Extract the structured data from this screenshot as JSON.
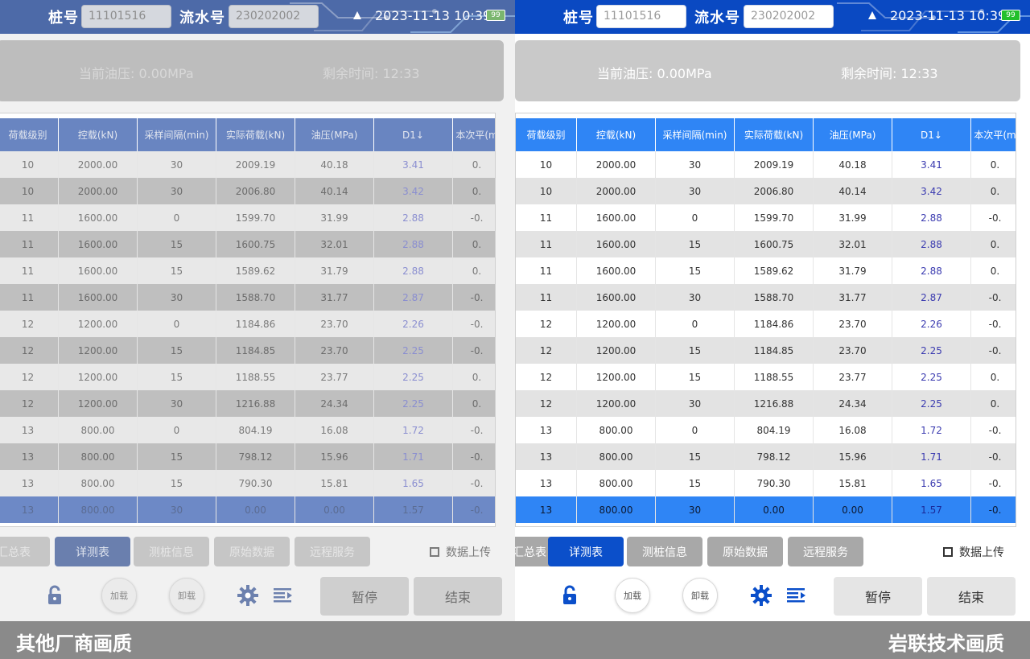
{
  "header": {
    "pile_label": "桩号",
    "pile_value": "11101516",
    "serial_label": "流水号",
    "serial_value": "230202002",
    "datetime": "2023-11-13  10:39",
    "battery": "99"
  },
  "status": {
    "pressure_label": "当前油压: 0.00MPa",
    "remaining_label": "剩余时间: 12:33"
  },
  "table": {
    "headers": [
      "荷载级别",
      "控载(kN)",
      "采样间隔(min)",
      "实际荷载(kN)",
      "油压(MPa)",
      "D1↓",
      "本次平(m"
    ],
    "rows": [
      [
        "10",
        "2000.00",
        "30",
        "2009.19",
        "40.18",
        "3.41",
        "0."
      ],
      [
        "10",
        "2000.00",
        "30",
        "2006.80",
        "40.14",
        "3.42",
        "0."
      ],
      [
        "11",
        "1600.00",
        "0",
        "1599.70",
        "31.99",
        "2.88",
        "-0."
      ],
      [
        "11",
        "1600.00",
        "15",
        "1600.75",
        "32.01",
        "2.88",
        "0."
      ],
      [
        "11",
        "1600.00",
        "15",
        "1589.62",
        "31.79",
        "2.88",
        "0."
      ],
      [
        "11",
        "1600.00",
        "30",
        "1588.70",
        "31.77",
        "2.87",
        "-0."
      ],
      [
        "12",
        "1200.00",
        "0",
        "1184.86",
        "23.70",
        "2.26",
        "-0."
      ],
      [
        "12",
        "1200.00",
        "15",
        "1184.85",
        "23.70",
        "2.25",
        "-0."
      ],
      [
        "12",
        "1200.00",
        "15",
        "1188.55",
        "23.77",
        "2.25",
        "0."
      ],
      [
        "12",
        "1200.00",
        "30",
        "1216.88",
        "24.34",
        "2.25",
        "0."
      ],
      [
        "13",
        "800.00",
        "0",
        "804.19",
        "16.08",
        "1.72",
        "-0."
      ],
      [
        "13",
        "800.00",
        "15",
        "798.12",
        "15.96",
        "1.71",
        "-0."
      ],
      [
        "13",
        "800.00",
        "15",
        "790.30",
        "15.81",
        "1.65",
        "-0."
      ],
      [
        "13",
        "800.00",
        "30",
        "0.00",
        "0.00",
        "1.57",
        "-0."
      ]
    ]
  },
  "tabs": [
    "汇总表",
    "详测表",
    "测桩信息",
    "原始数据",
    "远程服务"
  ],
  "upload_label": "数据上传",
  "controls": {
    "load_label": "加载",
    "unload_label": "卸载",
    "pause_label": "暂停",
    "end_label": "结束"
  },
  "captions": {
    "left": "其他厂商画质",
    "right": "岩联技术画质"
  },
  "colors": {
    "primary_blue": "#0a49c2",
    "header_blue": "#2f85f5",
    "caption_gray": "#8a8a8a"
  }
}
